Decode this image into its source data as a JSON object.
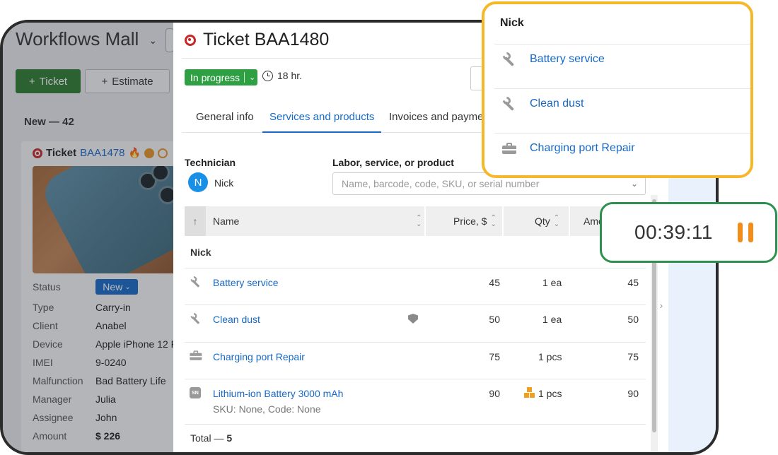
{
  "background": {
    "workspace_title": "Workflows Mall",
    "ticket_button": "Ticket",
    "estimate_button": "Estimate",
    "column_title": "New — 42",
    "card": {
      "ticket_prefix": "Ticket",
      "ticket_id": "BAA1478",
      "properties": [
        {
          "label": "Status",
          "value": "New"
        },
        {
          "label": "Type",
          "value": "Carry-in"
        },
        {
          "label": "Client",
          "value": "Anabel"
        },
        {
          "label": "Device",
          "value": "Apple iPhone 12 P"
        },
        {
          "label": "IMEI",
          "value": "9-0240"
        },
        {
          "label": "Malfunction",
          "value": "Bad Battery Life"
        },
        {
          "label": "Manager",
          "value": "Julia"
        },
        {
          "label": "Assignee",
          "value": "John"
        },
        {
          "label": "Amount",
          "value": "$ 226"
        }
      ]
    }
  },
  "ticket": {
    "title": "Ticket BAA1480",
    "status": "In progress",
    "time_estimate": "18 hr.",
    "tabs": [
      "General info",
      "Services and products",
      "Invoices and payments"
    ],
    "active_tab_index": 1,
    "technician_label": "Technician",
    "technician_initial": "N",
    "technician_name": "Nick",
    "product_search_label": "Labor, service, or product",
    "product_search_placeholder": "Name, barcode, code, SKU, or serial number",
    "columns": {
      "name": "Name",
      "price": "Price, $",
      "qty": "Qty",
      "amount": "Amo"
    },
    "group_name": "Nick",
    "rows": [
      {
        "icon": "wrench-icon",
        "name": "Battery service",
        "price": "45",
        "qty": "1 ea",
        "amount": "45"
      },
      {
        "icon": "wrench-icon",
        "name": "Clean dust",
        "price": "50",
        "qty": "1 ea",
        "amount": "50"
      },
      {
        "icon": "toolbox-icon",
        "name": "Charging port Repair",
        "price": "75",
        "qty": "1 pcs",
        "amount": "75"
      },
      {
        "icon": "sn-icon",
        "name": "Lithium-ion Battery 3000 mAh",
        "sub": "SKU: None, Code: None",
        "price": "90",
        "qty": "1 pcs",
        "amount": "90"
      }
    ],
    "total_label": "Total — ",
    "total_count": "5"
  },
  "popup": {
    "title": "Nick",
    "items": [
      {
        "icon": "wrench-icon",
        "label": "Battery service"
      },
      {
        "icon": "wrench-icon",
        "label": "Clean dust"
      },
      {
        "icon": "toolbox-icon",
        "label": "Charging port Repair"
      }
    ]
  },
  "timer": {
    "elapsed": "00:39:11",
    "state": "running"
  },
  "colors": {
    "accent_blue": "#1769c7",
    "status_green": "#2ea043",
    "popup_border": "#f5b82a",
    "timer_border": "#2f8f4e",
    "pause_orange": "#f28c1a"
  }
}
